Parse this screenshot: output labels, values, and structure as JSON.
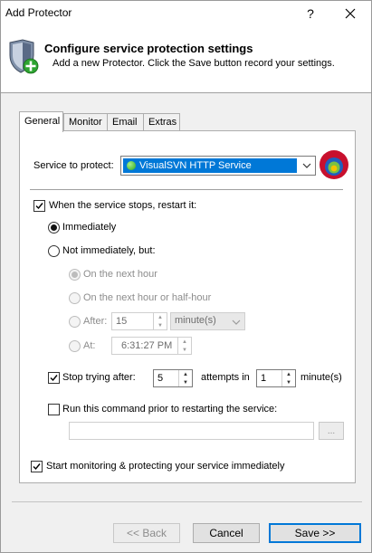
{
  "window": {
    "title": "Add Protector",
    "help_symbol": "?",
    "close_symbol": "✕"
  },
  "header": {
    "title": "Configure service protection settings",
    "subtitle": "Add a new Protector. Click the Save button record your settings.",
    "icon": "shield-add-icon"
  },
  "tabs": [
    {
      "label": "General",
      "active": true
    },
    {
      "label": "Monitor",
      "active": false
    },
    {
      "label": "Email",
      "active": false
    },
    {
      "label": "Extras",
      "active": false
    }
  ],
  "general": {
    "service_label": "Service to protect:",
    "service_value": "VisualSVN HTTP Service",
    "restart_label": "When the service stops, restart it:",
    "restart_checked": true,
    "immediately_label": "Immediately",
    "immediately_selected": true,
    "not_immediately_label": "Not immediately, but:",
    "next_hour_label": "On the next hour",
    "next_half_hour_label": "On the next hour or half-hour",
    "after_label": "After:",
    "after_value": "15",
    "after_unit": "minute(s)",
    "at_label": "At:",
    "at_value": "6:31:27 PM",
    "stop_trying_label": "Stop trying after:",
    "stop_trying_checked": true,
    "attempts_value": "5",
    "attempts_in_label": "attempts in",
    "minutes_value": "1",
    "minutes_label": "minute(s)",
    "run_command_label": "Run this command prior to restarting the service:",
    "run_command_checked": false,
    "command_value": "",
    "browse_label": "...",
    "start_monitoring_label": "Start monitoring & protecting your service immediately",
    "start_monitoring_checked": true
  },
  "footer": {
    "back_label": "<< Back",
    "cancel_label": "Cancel",
    "save_label": "Save >>"
  },
  "colors": {
    "selection": "#0078d7",
    "accent_border": "#0078d7",
    "dialog_bg": "#f0f0f0"
  }
}
